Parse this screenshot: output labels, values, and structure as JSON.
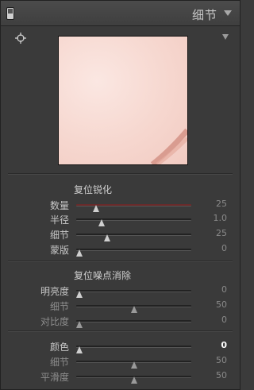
{
  "panel": {
    "title": "细节"
  },
  "sharpening": {
    "reset_label": "复位锐化",
    "sliders": [
      {
        "label": "数量",
        "value": "25",
        "fraction": 0.17
      },
      {
        "label": "半径",
        "value": "1.0",
        "fraction": 0.22
      },
      {
        "label": "细节",
        "value": "25",
        "fraction": 0.27
      },
      {
        "label": "蒙版",
        "value": "0",
        "fraction": 0.03
      }
    ]
  },
  "noise_reduction": {
    "reset_label": "复位噪点消除",
    "luminance": [
      {
        "label": "明亮度",
        "value": "0",
        "fraction": 0.03
      },
      {
        "label": "细节",
        "value": "50",
        "fraction": 0.5
      },
      {
        "label": "对比度",
        "value": "0",
        "fraction": 0.03
      }
    ],
    "color": [
      {
        "label": "颜色",
        "value": "0",
        "fraction": 0.03
      },
      {
        "label": "细节",
        "value": "50",
        "fraction": 0.5
      },
      {
        "label": "平滑度",
        "value": "50",
        "fraction": 0.5
      }
    ]
  }
}
